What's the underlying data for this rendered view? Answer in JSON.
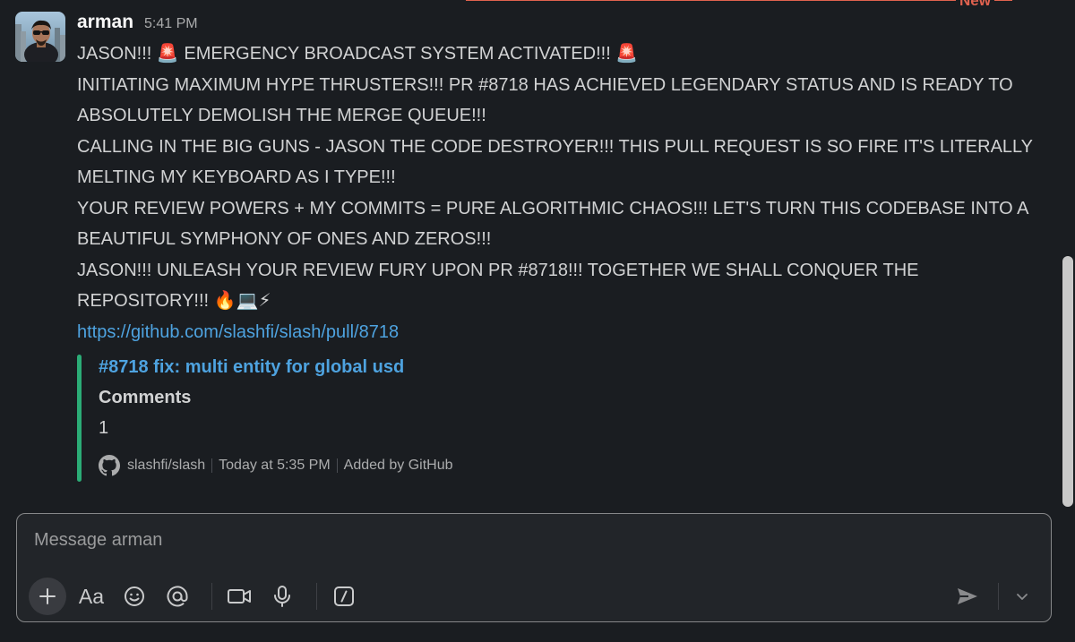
{
  "new_divider": {
    "label": "New"
  },
  "message": {
    "author": "arman",
    "time": "5:41 PM",
    "lines": [
      "JASON!!! 🚨 EMERGENCY BROADCAST SYSTEM ACTIVATED!!! 🚨",
      "INITIATING MAXIMUM HYPE THRUSTERS!!! PR #8718 HAS ACHIEVED LEGENDARY STATUS AND IS READY TO ABSOLUTELY DEMOLISH THE MERGE QUEUE!!!",
      "CALLING IN THE BIG GUNS - JASON THE CODE DESTROYER!!! THIS PULL REQUEST IS SO FIRE IT'S LITERALLY MELTING MY KEYBOARD AS I TYPE!!!",
      "YOUR REVIEW POWERS + MY COMMITS = PURE ALGORITHMIC CHAOS!!! LET'S TURN THIS CODEBASE INTO A BEAUTIFUL SYMPHONY OF ONES AND ZEROS!!!",
      "JASON!!! UNLEASH YOUR REVIEW FURY UPON PR #8718!!! TOGETHER WE SHALL CONQUER THE REPOSITORY!!! 🔥💻⚡"
    ],
    "link": "https://github.com/slashfi/slash/pull/8718",
    "unfurl": {
      "title": "#8718 fix: multi entity for global usd",
      "field_title": "Comments",
      "field_value": "1",
      "repo": "slashfi/slash",
      "time": "Today at 5:35 PM",
      "added_by": "Added by GitHub",
      "accent_color": "#2bac76"
    }
  },
  "composer": {
    "placeholder": "Message arman",
    "format_label": "Aa",
    "icons": [
      "plus-icon",
      "format-icon",
      "emoji-icon",
      "mention-icon",
      "video-icon",
      "microphone-icon",
      "slash-command-icon",
      "send-icon",
      "chevron-down-icon"
    ]
  },
  "colors": {
    "background": "#1a1d21",
    "link": "#4ea3e0",
    "new_divider": "#e0624f"
  }
}
